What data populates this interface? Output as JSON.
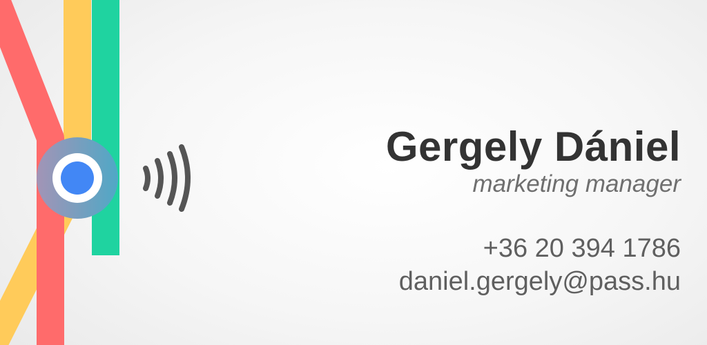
{
  "contact": {
    "name": "Gergely Dániel",
    "title": "marketing manager",
    "phone": "+36 20 394 1786",
    "email": "daniel.gergely@pass.hu"
  },
  "graphic": {
    "colors": {
      "red_line": "#ff6b6b",
      "yellow_line": "#ffcb5a",
      "green_line": "#1fd3a0",
      "station_ring_start": "#a394b6",
      "station_ring_end": "#4fa8c6",
      "station_dot": "#4287f5",
      "signal_waves": "#555555"
    },
    "icons": [
      "transit-map-lines",
      "station-marker-icon",
      "contactless-signal-icon"
    ]
  }
}
